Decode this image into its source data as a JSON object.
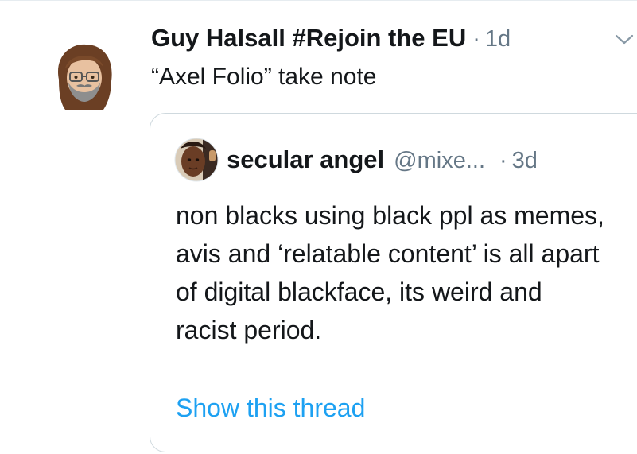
{
  "tweet": {
    "author": "Guy Halsall #Rejoin the EU",
    "separator": "·",
    "time": "1d",
    "text": "“Axel Folio” take note"
  },
  "quoted_tweet": {
    "author": "secular angel",
    "handle": "@mixe...",
    "separator": "·",
    "time": "3d",
    "text": "non blacks using black ppl as memes, avis and ‘relatable content’ is all apart of digital blackface, its weird and racist period.",
    "show_thread_label": "Show this thread"
  },
  "icons": {
    "tweet_avatar": "memoji-avatar",
    "quoted_avatar": "profile-photo",
    "menu": "chevron-down-icon"
  },
  "colors": {
    "text": "#14171a",
    "secondary": "#657786",
    "link": "#1da1f2",
    "border": "#cfd9de"
  }
}
